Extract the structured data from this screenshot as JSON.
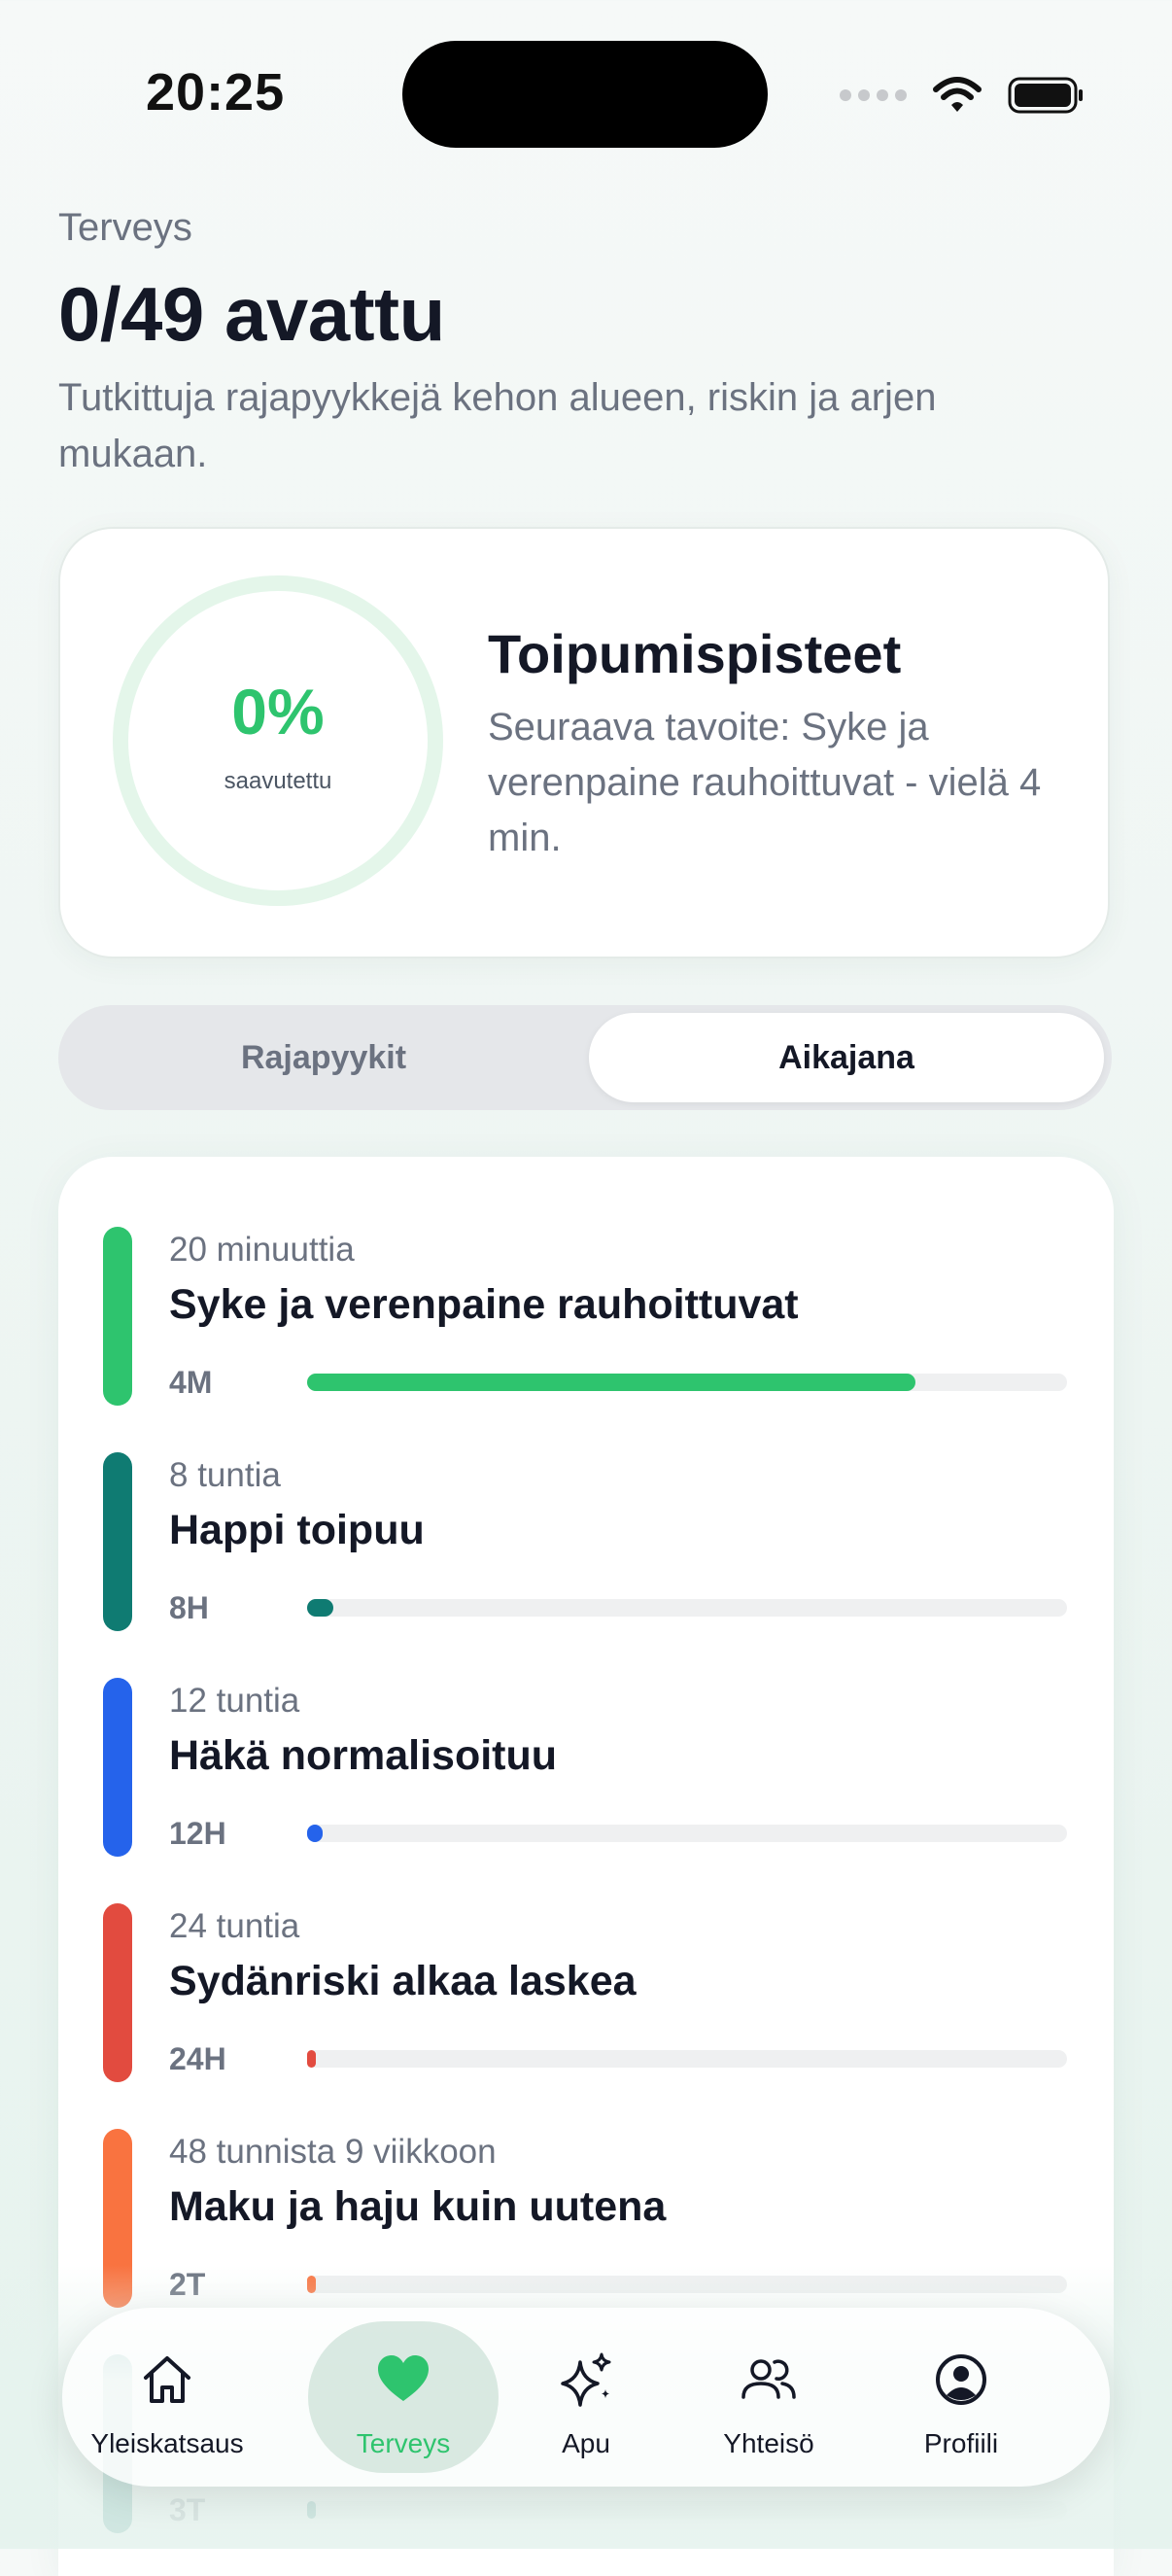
{
  "status_bar": {
    "time": "20:25"
  },
  "header": {
    "eyebrow": "Terveys",
    "title": "0/49 avattu",
    "subtitle": "Tutkittuja rajapyykkejä kehon alueen, riskin ja arjen mukaan."
  },
  "recovery": {
    "percent_text": "0%",
    "percent_label": "saavutettu",
    "title": "Toipumispisteet",
    "next_goal": "Seuraava tavoite: Syke ja verenpaine rauhoittuvat - vielä 4 min."
  },
  "segmented": {
    "tabs": [
      {
        "label": "Rajapyykit",
        "active": false
      },
      {
        "label": "Aikajana",
        "active": true
      }
    ]
  },
  "timeline": {
    "items": [
      {
        "time": "20 minuuttia",
        "title": "Syke ja verenpaine rauhoittuvat",
        "badge": "4M",
        "progress": 0.8,
        "color": "#2ec46e"
      },
      {
        "time": "8 tuntia",
        "title": "Happi toipuu",
        "badge": "8H",
        "progress": 0.035,
        "color": "#0f7b72"
      },
      {
        "time": "12 tuntia",
        "title": "Häkä normalisoituu",
        "badge": "12H",
        "progress": 0.02,
        "color": "#2563eb"
      },
      {
        "time": "24 tuntia",
        "title": "Sydänriski alkaa laskea",
        "badge": "24H",
        "progress": 0.01,
        "color": "#e24b3f"
      },
      {
        "time": "48 tunnista 9 viikkoon",
        "title": "Maku ja haju kuin uutena",
        "badge": "2T",
        "progress": 0.005,
        "color": "#f97340"
      },
      {
        "time": "",
        "title": "",
        "badge": "3T",
        "progress": 0.003,
        "color": "#0f7b72"
      }
    ]
  },
  "bottom_nav": {
    "items": [
      {
        "label": "Yleiskatsaus",
        "icon": "home-icon",
        "active": false
      },
      {
        "label": "Terveys",
        "icon": "heart-icon",
        "active": true
      },
      {
        "label": "Apu",
        "icon": "sparkles-icon",
        "active": false
      },
      {
        "label": "Yhteisö",
        "icon": "people-icon",
        "active": false
      },
      {
        "label": "Profiili",
        "icon": "profile-icon",
        "active": false
      }
    ]
  },
  "colors": {
    "accent": "#2ec46e",
    "ring_track": "#e4f6ea"
  }
}
